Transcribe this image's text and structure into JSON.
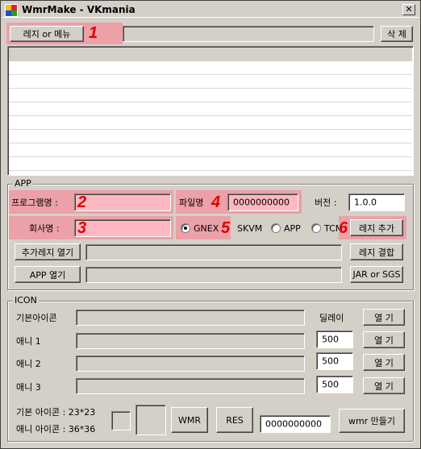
{
  "window": {
    "title": "WmrMake - VKmania",
    "close_label": "✕"
  },
  "top": {
    "reg_menu_button": "레지 or 메뉴",
    "delete_button": "삭 제",
    "path_value": ""
  },
  "annotations": {
    "n1": "1",
    "n2": "2",
    "n3": "3",
    "n4": "4",
    "n5": "5",
    "n6": "6"
  },
  "app": {
    "group_title": "APP",
    "program_name_label": "프로그램명 :",
    "program_name_value": "",
    "filename_label": "파일명",
    "filename_value": "0000000000",
    "version_label": "버전 :",
    "version_value": "1.0.0",
    "company_label": "회사명 :",
    "company_value": "",
    "radio_options": [
      "GNEX",
      "SKVM",
      "APP",
      "TCM"
    ],
    "selected_radio": "GNEX",
    "add_reg_button": "레지 추가",
    "open_extra_reg_button": "추가레지 열기",
    "merge_reg_button": "레지 결합",
    "open_app_button": "APP 열기",
    "jar_sgs_button": "JAR or SGS",
    "extra_reg_path": "",
    "app_path": ""
  },
  "icon": {
    "group_title": "ICON",
    "delay_label": "딜레이",
    "rows": [
      {
        "label": "기본아이콘",
        "path": "",
        "delay": "",
        "open": "열 기"
      },
      {
        "label": "애니 1",
        "path": "",
        "delay": "500",
        "open": "열 기"
      },
      {
        "label": "애니 2",
        "path": "",
        "delay": "500",
        "open": "열 기"
      },
      {
        "label": "애니 3",
        "path": "",
        "delay": "500",
        "open": "열 기"
      }
    ],
    "basic_size_text": "기본 아이콘 : 23*23",
    "ani_size_text": "애니 아이콘 : 36*36",
    "wmr_button": "WMR",
    "res_button": "RES",
    "output_value": "0000000000",
    "make_button": "wmr 만들기"
  }
}
